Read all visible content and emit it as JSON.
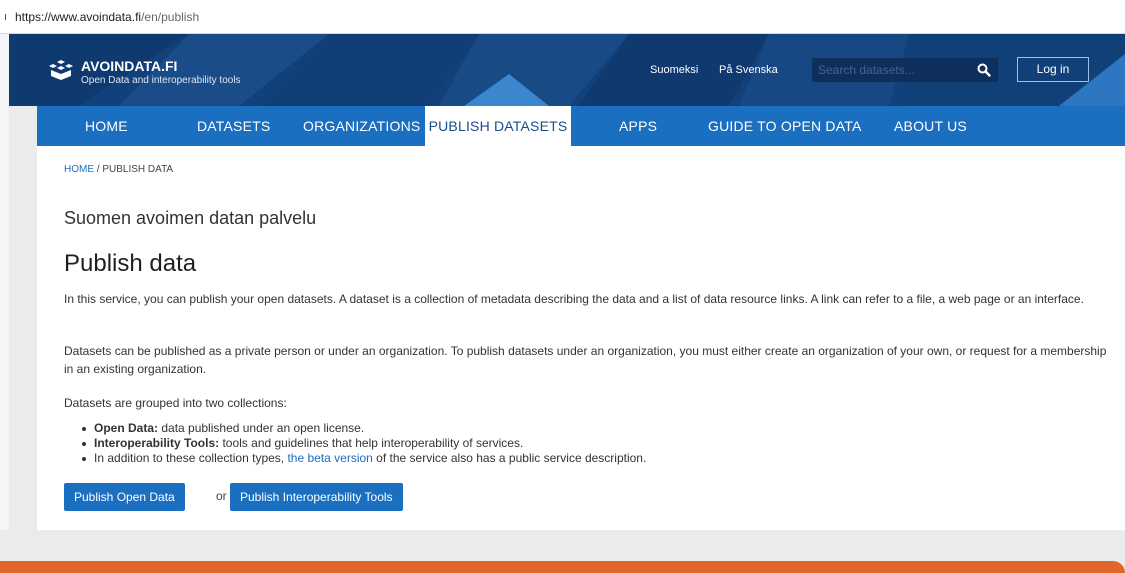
{
  "browser": {
    "url_host": "https://www.avoindata.fi",
    "url_path": "/en/publish"
  },
  "header": {
    "brand": "AVOINDATA.FI",
    "brand_sub": "Open Data and interoperability tools",
    "lang_fi": "Suomeksi",
    "lang_sv": "På Svenska",
    "search_placeholder": "Search datasets...",
    "login_label": "Log in"
  },
  "nav": {
    "items": [
      "HOME",
      "DATASETS",
      "ORGANIZATIONS",
      "PUBLISH DATASETS",
      "APPS",
      "GUIDE TO OPEN DATA",
      "ABOUT US"
    ],
    "active_index": 3
  },
  "breadcrumb": {
    "home": "HOME",
    "sep": "/",
    "current": "PUBLISH DATA"
  },
  "content": {
    "subtitle": "Suomen avoimen datan palvelu",
    "title": "Publish data",
    "para1": "In this service, you can publish your open datasets. A dataset is a collection of metadata describing the data and a list of data resource links. A link can refer to a file, a web page or an interface.",
    "para2": "Datasets can be published as a private person or under an organization. To publish datasets under an organization, you must either create an organization of your own, or request for a membership in an existing organization.",
    "para3": "Datasets are grouped into two collections:",
    "bullets": [
      {
        "bold": "Open Data:",
        "text": " data published under an open license."
      },
      {
        "bold": "Interoperability Tools:",
        "text": " tools and guidelines that help interoperability of services."
      }
    ],
    "bullet3_pre": "In addition to these collection types, ",
    "bullet3_link": "the beta version",
    "bullet3_post": " of the service also has a public service description.",
    "btn_open": "Publish Open Data",
    "or": "or",
    "btn_interop": "Publish Interoperability Tools"
  },
  "colors": {
    "header_bg": "#12407a",
    "nav_bg": "#1a6fc1",
    "accent_orange": "#e0662a",
    "link": "#1a6fc1"
  }
}
